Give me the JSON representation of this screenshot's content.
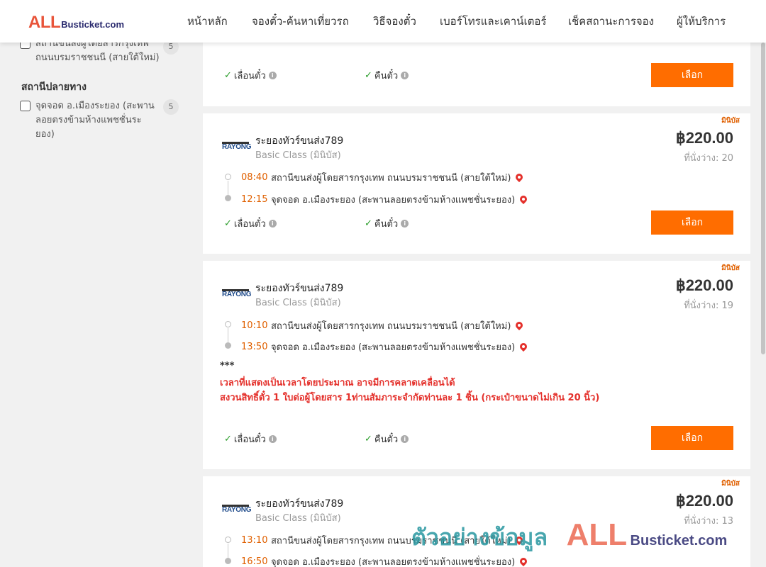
{
  "header": {
    "logo_all": "ALL",
    "logo_rest": "Busticket.com",
    "nav": [
      "หน้าหลัก",
      "จองตั๋ว-ค้นหาเที่ยวรถ",
      "วิธีจองตั๋ว",
      "เบอร์โทรและเคาน์เตอร์",
      "เช็คสถานะการจอง",
      "ผู้ให้บริการ"
    ]
  },
  "sidebar": {
    "origin_item": {
      "label": "สถานีขนส่งผู้โดยสารกรุงเทพ ถนนบรมราชชนนี (สายใต้ใหม่)",
      "count": "5"
    },
    "destination_title": "สถานีปลายทาง",
    "destination_item": {
      "label": "จุดจอด อ.เมืองระยอง (สะพานลอยตรงข้ามห้างแพชชั่นระยอง)",
      "count": "5"
    }
  },
  "common": {
    "change_ticket": "เลื่อนตั๋ว",
    "refund_ticket": "คืนตั๋ว",
    "select_label": "เลือก",
    "mini_tag": "มินิบัส",
    "operator_logo_text": "RAYONG"
  },
  "trips": [
    {
      "operator": "ระยองทัวร์ขนส่ง789",
      "class": "Basic Class (มินิบัส)",
      "price": "฿220.00",
      "seats": "ที่นั่งว่าง: 20",
      "depart_time": "08:40",
      "depart_place": "สถานีขนส่งผู้โดยสารกรุงเทพ ถนนบรมราชชนนี (สายใต้ใหม่)",
      "arrive_time": "12:15",
      "arrive_place": "จุดจอด อ.เมืองระยอง (สะพานลอยตรงข้ามห้างแพชชั่นระยอง)"
    },
    {
      "operator": "ระยองทัวร์ขนส่ง789",
      "class": "Basic Class (มินิบัส)",
      "price": "฿220.00",
      "seats": "ที่นั่งว่าง: 19",
      "depart_time": "10:10",
      "depart_place": "สถานีขนส่งผู้โดยสารกรุงเทพ ถนนบรมราชชนนี (สายใต้ใหม่)",
      "arrive_time": "13:50",
      "arrive_place": "จุดจอด อ.เมืองระยอง (สะพานลอยตรงข้ามห้างแพชชั่นระยอง)",
      "note_stars": "***",
      "note_line1": "เวลาที่แสดงเป็นเวลาโดยประมาณ อาจมีการคลาดเคลื่อนได้",
      "note_line2": "สงวนสิทธิ์ตั๋ว 1 ใบต่อผู้โดยสาร 1ท่านสัมภาระจำกัดท่านละ 1 ชิ้น (กระเป๋าขนาดไม่เกิน 20 นิ้ว)"
    },
    {
      "operator": "ระยองทัวร์ขนส่ง789",
      "class": "Basic Class (มินิบัส)",
      "price": "฿220.00",
      "seats": "ที่นั่งว่าง: 13",
      "depart_time": "13:10",
      "depart_place": "สถานีขนส่งผู้โดยสารกรุงเทพ ถนนบรมราชชนนี (สายใต้ใหม่)",
      "arrive_time": "16:50",
      "arrive_place": "จุดจอด อ.เมืองระยอง (สะพานลอยตรงข้ามห้างแพชชั่นระยอง)"
    }
  ],
  "watermark": {
    "text_th": "ตัวอย่างข้อมูล",
    "logo_all": "ALL",
    "logo_rest": "Busticket.com"
  }
}
